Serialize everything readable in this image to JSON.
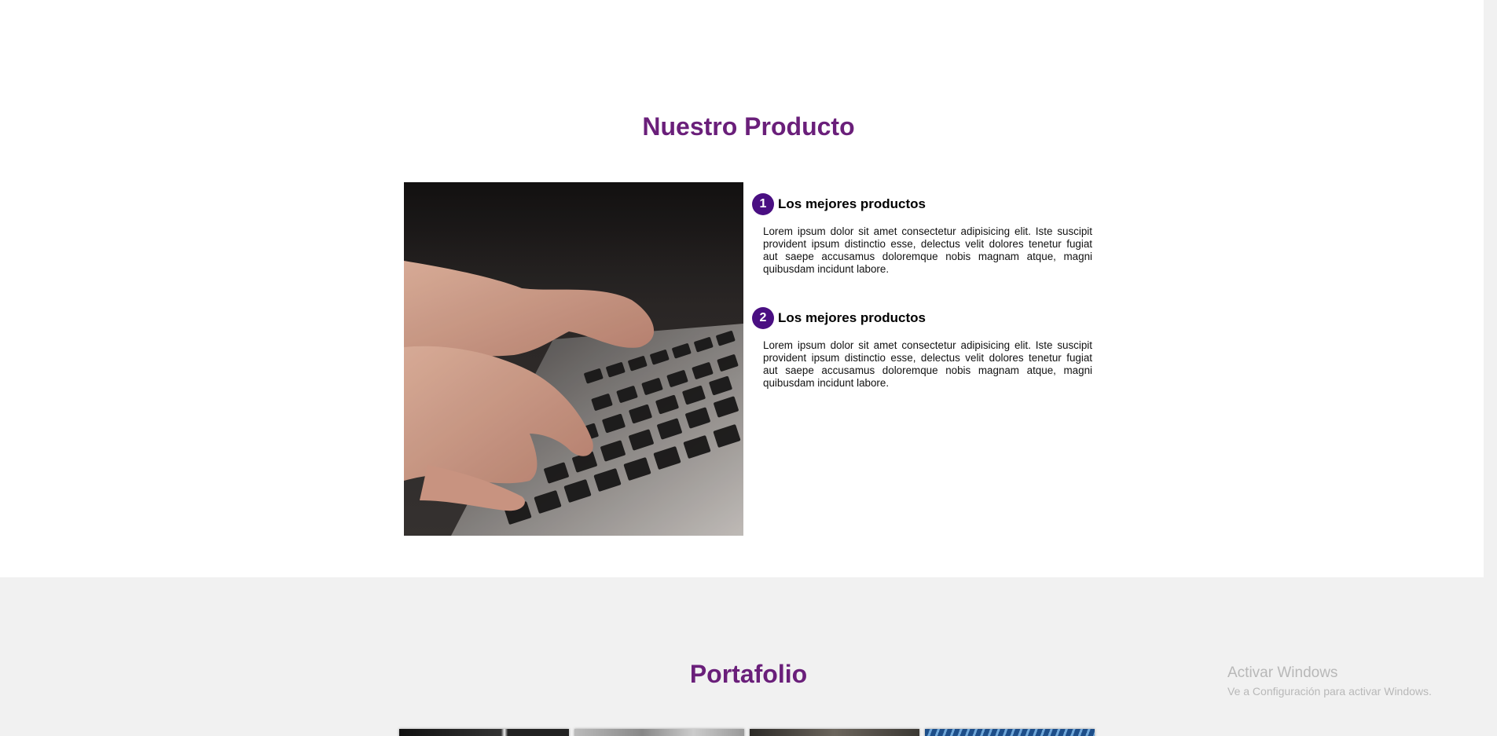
{
  "producto": {
    "title": "Nuestro Producto",
    "image": "laptop-typing-photo",
    "features": [
      {
        "number": "1",
        "title": "Los mejores productos",
        "text": "Lorem ipsum dolor sit amet consectetur adipisicing elit. Iste suscipit provident ipsum distinctio esse, delectus velit dolores tenetur fugiat aut saepe accusamus doloremque nobis magnam atque, magni quibusdam incidunt labore."
      },
      {
        "number": "2",
        "title": "Los mejores productos",
        "text": "Lorem ipsum dolor sit amet consectetur adipisicing elit. Iste suscipit provident ipsum distinctio esse, delectus velit dolores tenetur fugiat aut saepe accusamus doloremque nobis magnam atque, magni quibusdam incidunt labore."
      }
    ]
  },
  "portafolio": {
    "title": "Portafolio"
  },
  "watermark": {
    "title": "Activar Windows",
    "subtitle": "Ve a Configuración para activar Windows."
  },
  "colors": {
    "accent": "#6a1f7a",
    "badge": "#4a0f82",
    "section_bg": "#f1f1f1"
  }
}
